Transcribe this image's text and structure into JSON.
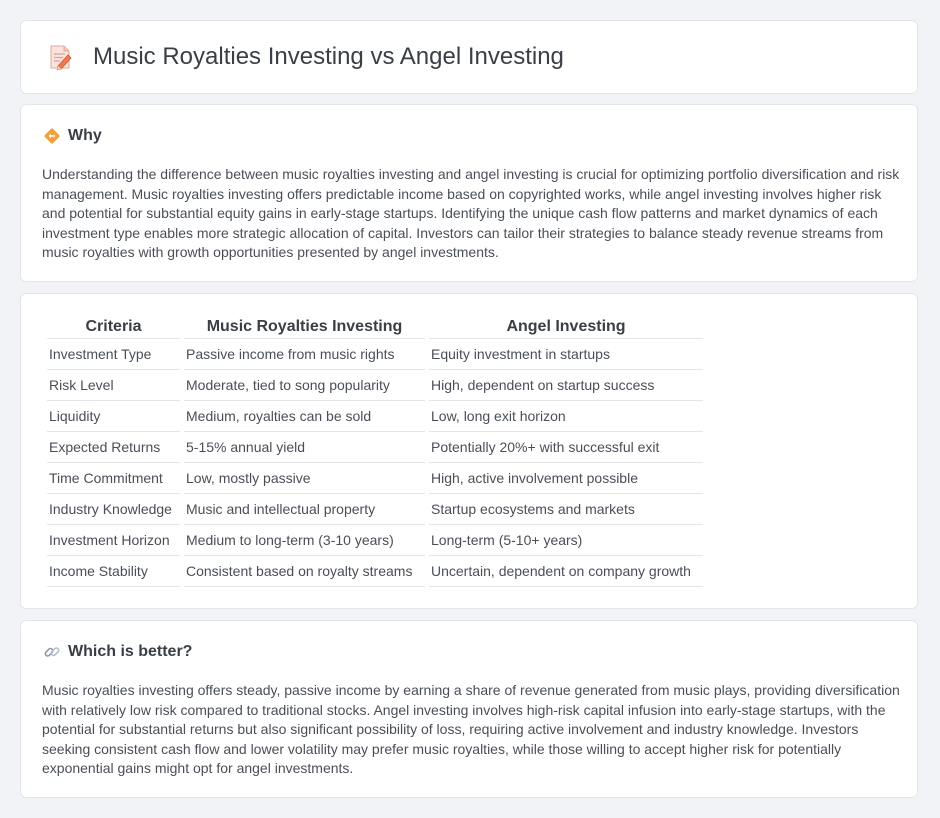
{
  "header": {
    "title": "Music Royalties Investing vs Angel Investing",
    "icon": "memo-pencil-icon"
  },
  "why": {
    "title": "Why",
    "icon": "diamond-arrows-icon",
    "text": "Understanding the difference between music royalties investing and angel investing is crucial for optimizing portfolio diversification and risk management. Music royalties investing offers predictable income based on copyrighted works, while angel investing involves higher risk and potential for substantial equity gains in early-stage startups. Identifying the unique cash flow patterns and market dynamics of each investment type enables more strategic allocation of capital. Investors can tailor their strategies to balance steady revenue streams from music royalties with growth opportunities presented by angel investments."
  },
  "table": {
    "headers": [
      "Criteria",
      "Music Royalties Investing",
      "Angel Investing"
    ],
    "rows": [
      [
        "Investment Type",
        "Passive income from music rights",
        "Equity investment in startups"
      ],
      [
        "Risk Level",
        "Moderate, tied to song popularity",
        "High, dependent on startup success"
      ],
      [
        "Liquidity",
        "Medium, royalties can be sold",
        "Low, long exit horizon"
      ],
      [
        "Expected Returns",
        "5-15% annual yield",
        "Potentially 20%+ with successful exit"
      ],
      [
        "Time Commitment",
        "Low, mostly passive",
        "High, active involvement possible"
      ],
      [
        "Industry Knowledge",
        "Music and intellectual property",
        "Startup ecosystems and markets"
      ],
      [
        "Investment Horizon",
        "Medium to long-term (3-10 years)",
        "Long-term (5-10+ years)"
      ],
      [
        "Income Stability",
        "Consistent based on royalty streams",
        "Uncertain, dependent on company growth"
      ]
    ]
  },
  "better": {
    "title": "Which is better?",
    "icon": "link-icon",
    "text": "Music royalties investing offers steady, passive income by earning a share of revenue generated from music plays, providing diversification with relatively low risk compared to traditional stocks. Angel investing involves high-risk capital infusion into early-stage startups, with the potential for substantial returns but also significant possibility of loss, requiring active involvement and industry knowledge. Investors seeking consistent cash flow and lower volatility may prefer music royalties, while those willing to accept higher risk for potentially exponential gains might opt for angel investments."
  },
  "colors": {
    "background": "#f1f3f7",
    "card": "#ffffff",
    "border": "#e2e5ea",
    "icon_orange": "#f0a030",
    "icon_pencil": "#e8704a"
  }
}
